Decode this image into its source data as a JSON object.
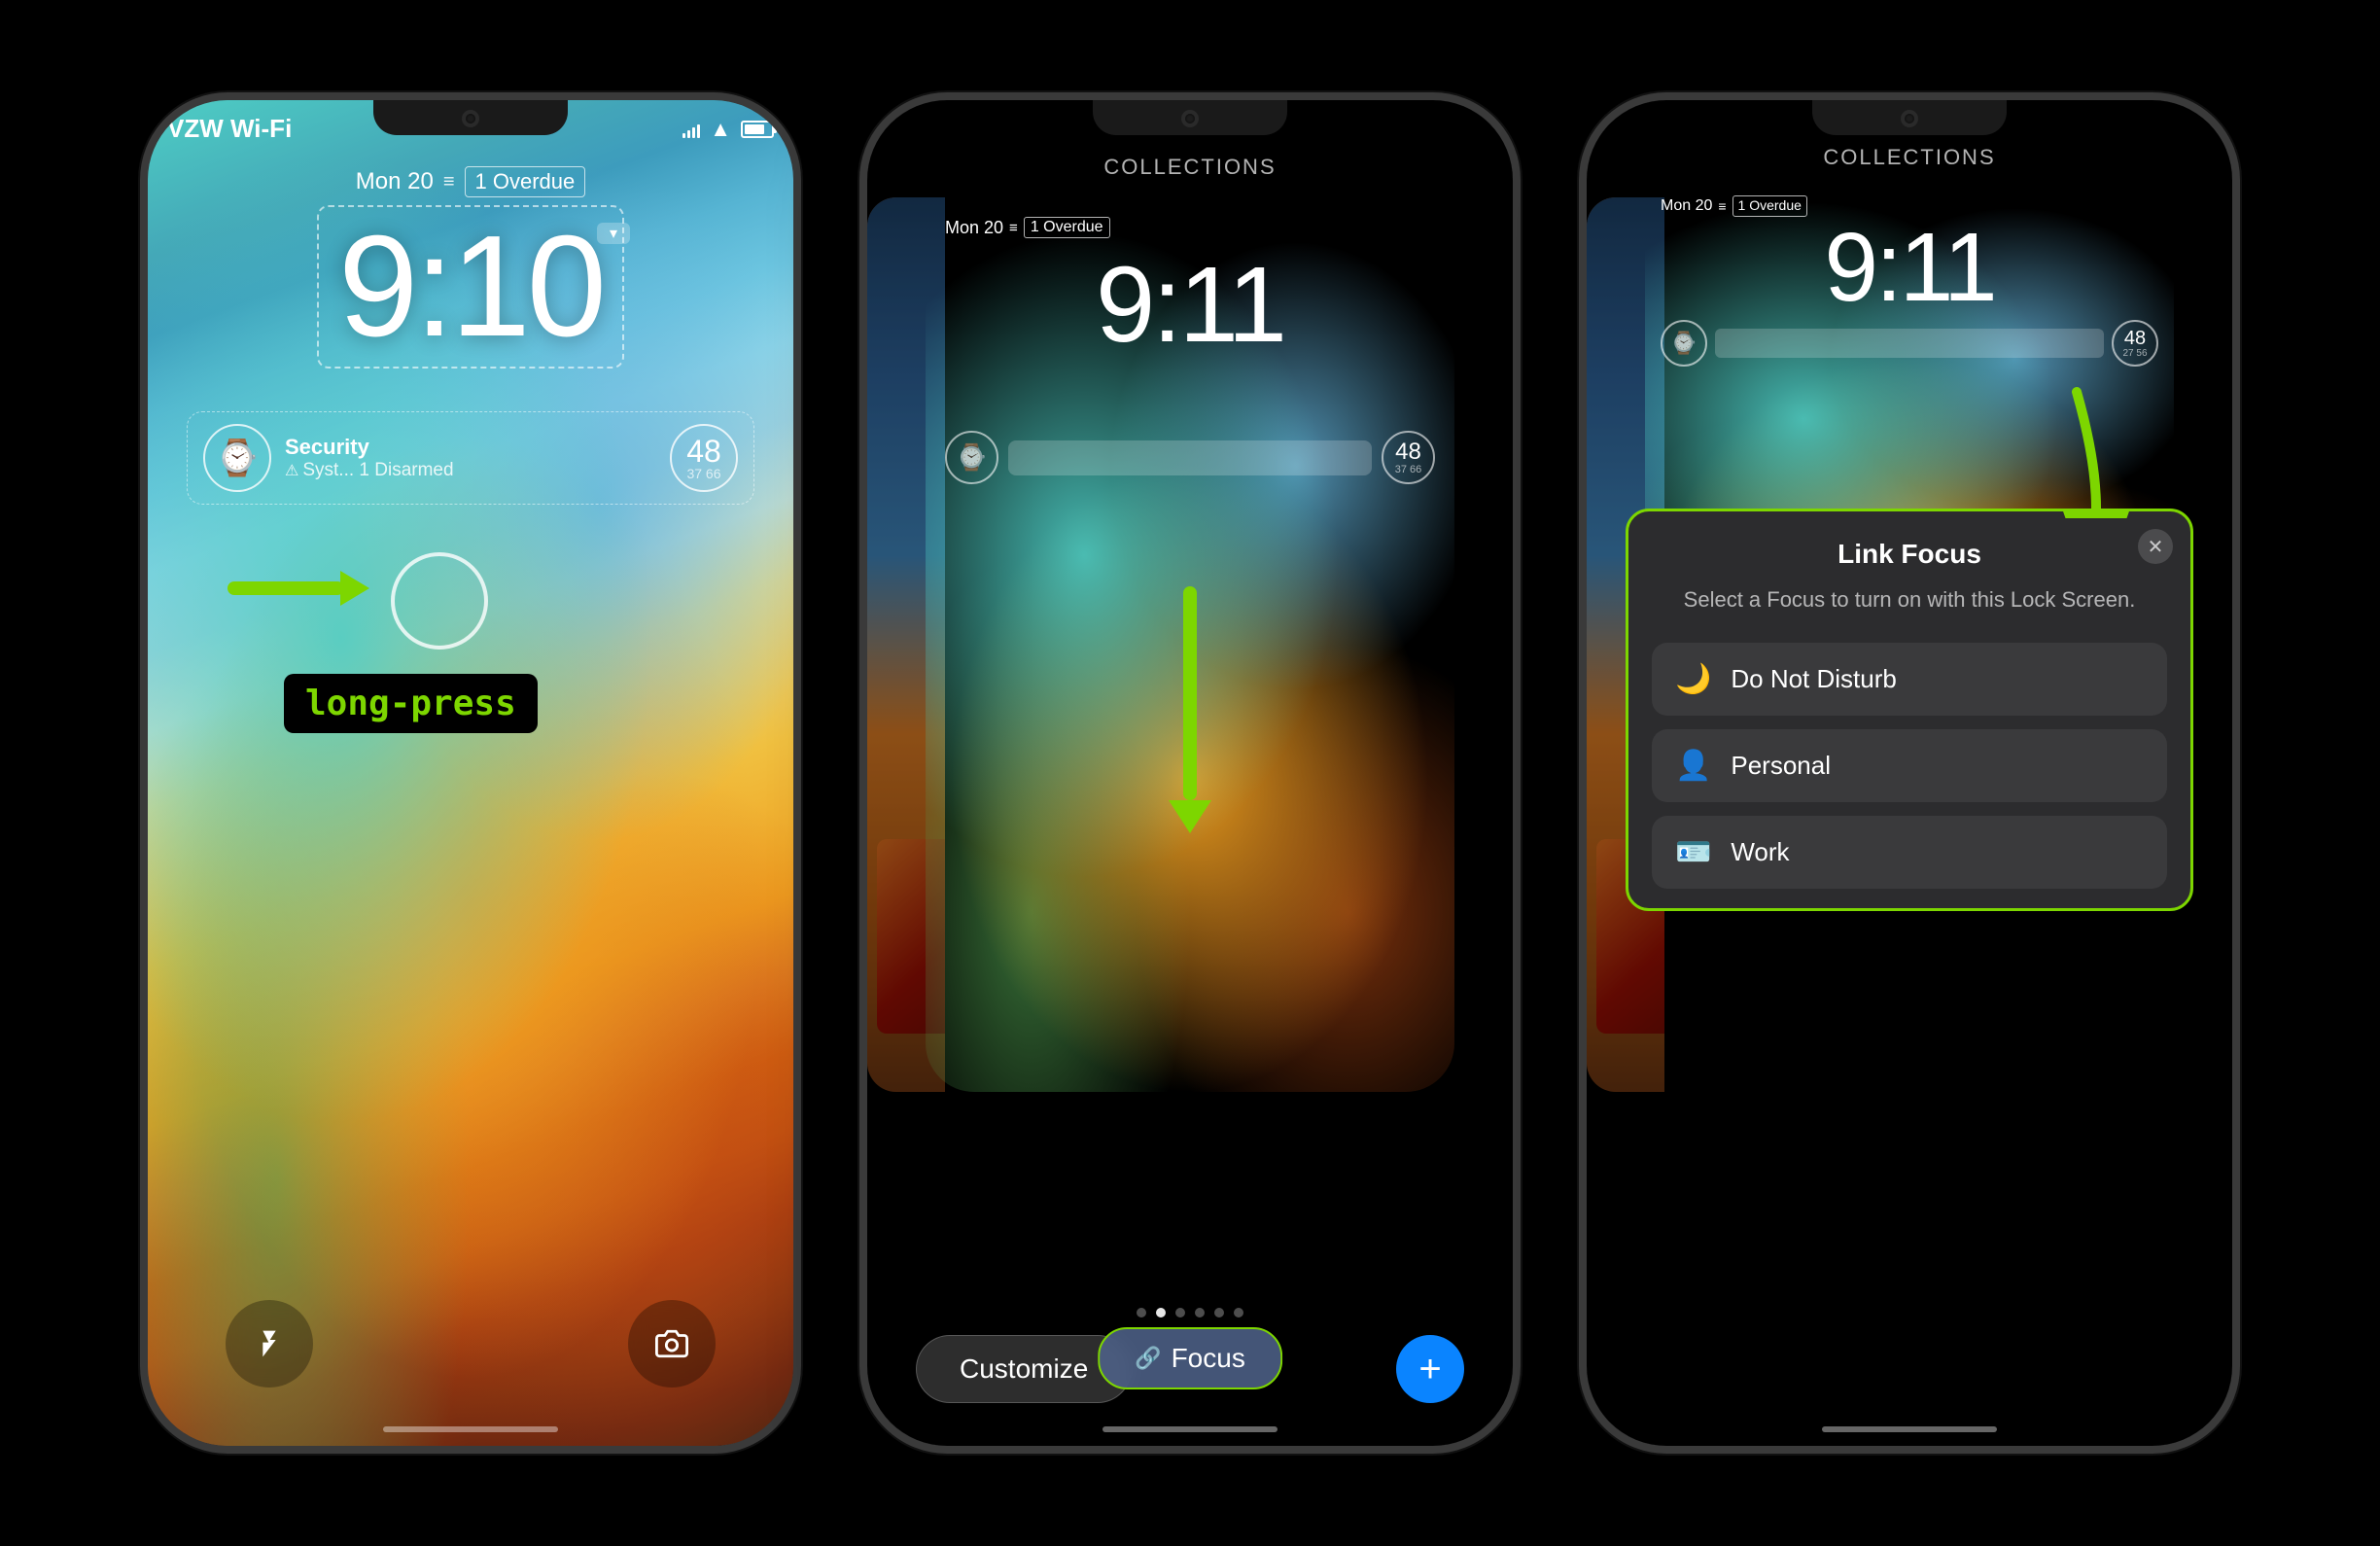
{
  "phone1": {
    "status": {
      "carrier": "VZW Wi-Fi",
      "wifi": "WiFi",
      "battery_level": "65%"
    },
    "lock_screen": {
      "date": "Mon 20",
      "overdue": "1 Overdue",
      "time": "9:10",
      "widget_title": "Security",
      "widget_subtitle": "Syst... 1 Disarmed",
      "widget_number": "48",
      "widget_number_sub": "37 66",
      "instruction": "long-press"
    },
    "buttons": {
      "flashlight": "🔦",
      "camera": "📷"
    }
  },
  "phone2": {
    "header": "COLLECTIONS",
    "lock_screen": {
      "date": "Mon 20",
      "overdue": "1 Overdue",
      "time": "9:11",
      "widget_number": "48",
      "widget_number_sub": "37 66"
    },
    "focus_button": "Focus",
    "customize_btn": "Customize",
    "add_btn": "+"
  },
  "phone3": {
    "header": "COLLECTIONS",
    "lock_screen": {
      "date": "Mon 20",
      "overdue": "1 Overdue",
      "time": "9:11",
      "widget_number": "48",
      "widget_number_sub": "27 56"
    },
    "modal": {
      "title": "Link Focus",
      "description": "Select a Focus to turn on with this Lock Screen.",
      "options": [
        {
          "icon": "🌙",
          "label": "Do Not Disturb"
        },
        {
          "icon": "👤",
          "label": "Personal"
        },
        {
          "icon": "🪪",
          "label": "Work"
        }
      ]
    }
  }
}
